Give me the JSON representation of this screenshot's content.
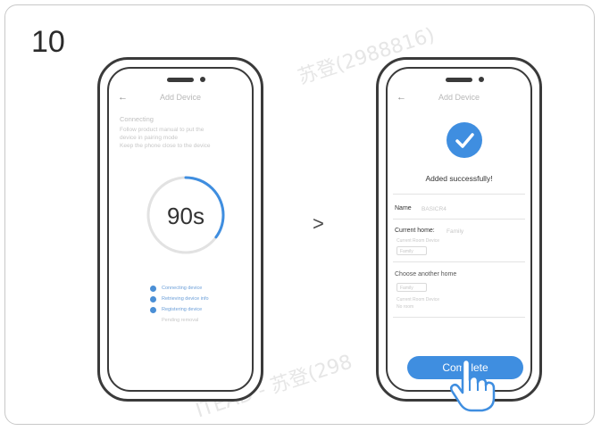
{
  "step_number": "10",
  "watermark_top": "苏登(2988816)",
  "watermark_bottom": "ITEAD - 苏登(298",
  "colors": {
    "accent": "#3f8ee0",
    "outline": "#3a3a3a",
    "faint": "#c7c7c7"
  },
  "icons": {
    "back": "arrow-left",
    "next": "chevron-right",
    "success": "check-circle",
    "pointer": "hand-pointer"
  },
  "phone_left": {
    "back_glyph": "←",
    "title": "Add Device",
    "section_title": "Connecting",
    "instructions": [
      "Follow product manual to put the",
      "device in pairing mode",
      "Keep the phone close to the device"
    ],
    "timer": "90s",
    "timer_progress": 0.35,
    "steps": [
      "Connecting device",
      "Retrieving device info",
      "Registering device"
    ],
    "pending": "Pending removal"
  },
  "chevron_glyph": ">",
  "phone_right": {
    "back_glyph": "←",
    "title": "Add Device",
    "success_text": "Added successfully!",
    "name_label": "Name",
    "name_value": "BASICR4",
    "current_home_label": "Current home:",
    "current_home_value": "Family",
    "current_room_label": "Current Room Device",
    "current_room_box": "Family",
    "another_home_label": "Choose another home",
    "another_home_box": "Family",
    "another_room_label": "Current Room Device",
    "another_room_value": "No room",
    "complete_label": "Complete"
  }
}
